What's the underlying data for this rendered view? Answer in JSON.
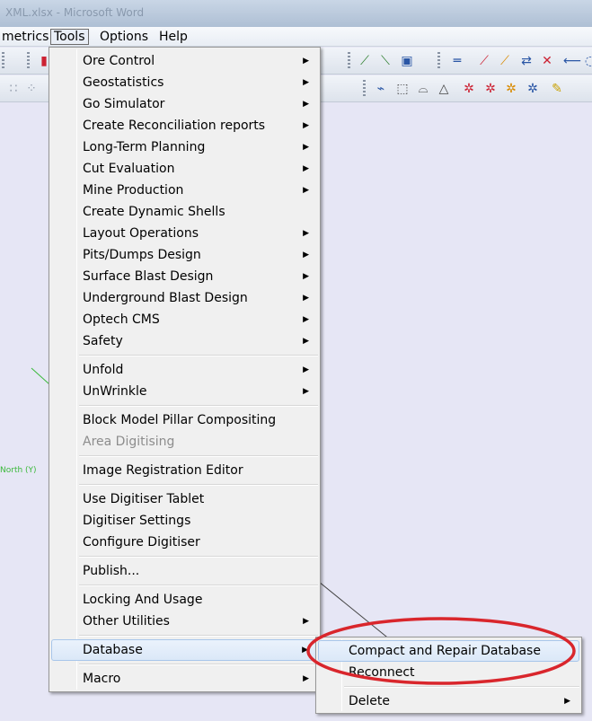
{
  "window": {
    "title": "XML.xlsx - Microsoft Word"
  },
  "menubar": {
    "items": [
      {
        "label": "metrics"
      },
      {
        "label": "Tools"
      },
      {
        "label": "Options"
      },
      {
        "label": "Help"
      }
    ]
  },
  "workspace": {
    "north_label": "North (Y)"
  },
  "tools_menu": {
    "items": [
      {
        "label": "Ore Control",
        "submenu": true
      },
      {
        "label": "Geostatistics",
        "submenu": true
      },
      {
        "label": "Go Simulator",
        "submenu": true
      },
      {
        "label": "Create Reconciliation reports",
        "submenu": true
      },
      {
        "label": "Long-Term Planning",
        "submenu": true
      },
      {
        "label": "Cut Evaluation",
        "submenu": true
      },
      {
        "label": "Mine Production",
        "submenu": true
      },
      {
        "label": "Create Dynamic Shells",
        "submenu": false
      },
      {
        "label": "Layout Operations",
        "submenu": true
      },
      {
        "label": "Pits/Dumps Design",
        "submenu": true
      },
      {
        "label": "Surface Blast Design",
        "submenu": true
      },
      {
        "label": "Underground Blast Design",
        "submenu": true
      },
      {
        "label": "Optech CMS",
        "submenu": true
      },
      {
        "label": "Safety",
        "submenu": true
      },
      {
        "label": "Unfold",
        "submenu": true
      },
      {
        "label": "UnWrinkle",
        "submenu": true
      },
      {
        "label": "Block Model Pillar Compositing",
        "submenu": false
      },
      {
        "label": "Area Digitising",
        "submenu": false,
        "disabled": true
      },
      {
        "label": "Image Registration Editor",
        "submenu": false
      },
      {
        "label": "Use Digitiser Tablet",
        "submenu": false
      },
      {
        "label": "Digitiser Settings",
        "submenu": false
      },
      {
        "label": "Configure Digitiser",
        "submenu": false
      },
      {
        "label": "Publish...",
        "submenu": false
      },
      {
        "label": "Locking And Usage",
        "submenu": false
      },
      {
        "label": "Other Utilities",
        "submenu": true
      },
      {
        "label": "Database",
        "submenu": true,
        "highlighted": true
      },
      {
        "label": "Macro",
        "submenu": true
      }
    ]
  },
  "database_submenu": {
    "items": [
      {
        "label": "Compact and Repair Database",
        "highlighted": true
      },
      {
        "label": "Reconnect"
      },
      {
        "label": "Delete",
        "submenu": true
      }
    ]
  },
  "icons": {
    "submenu_arrow": "▶"
  },
  "colors": {
    "annotation": "#d9262c",
    "highlight_border": "#a8c6ea",
    "menu_bg": "#f0f0f0"
  }
}
